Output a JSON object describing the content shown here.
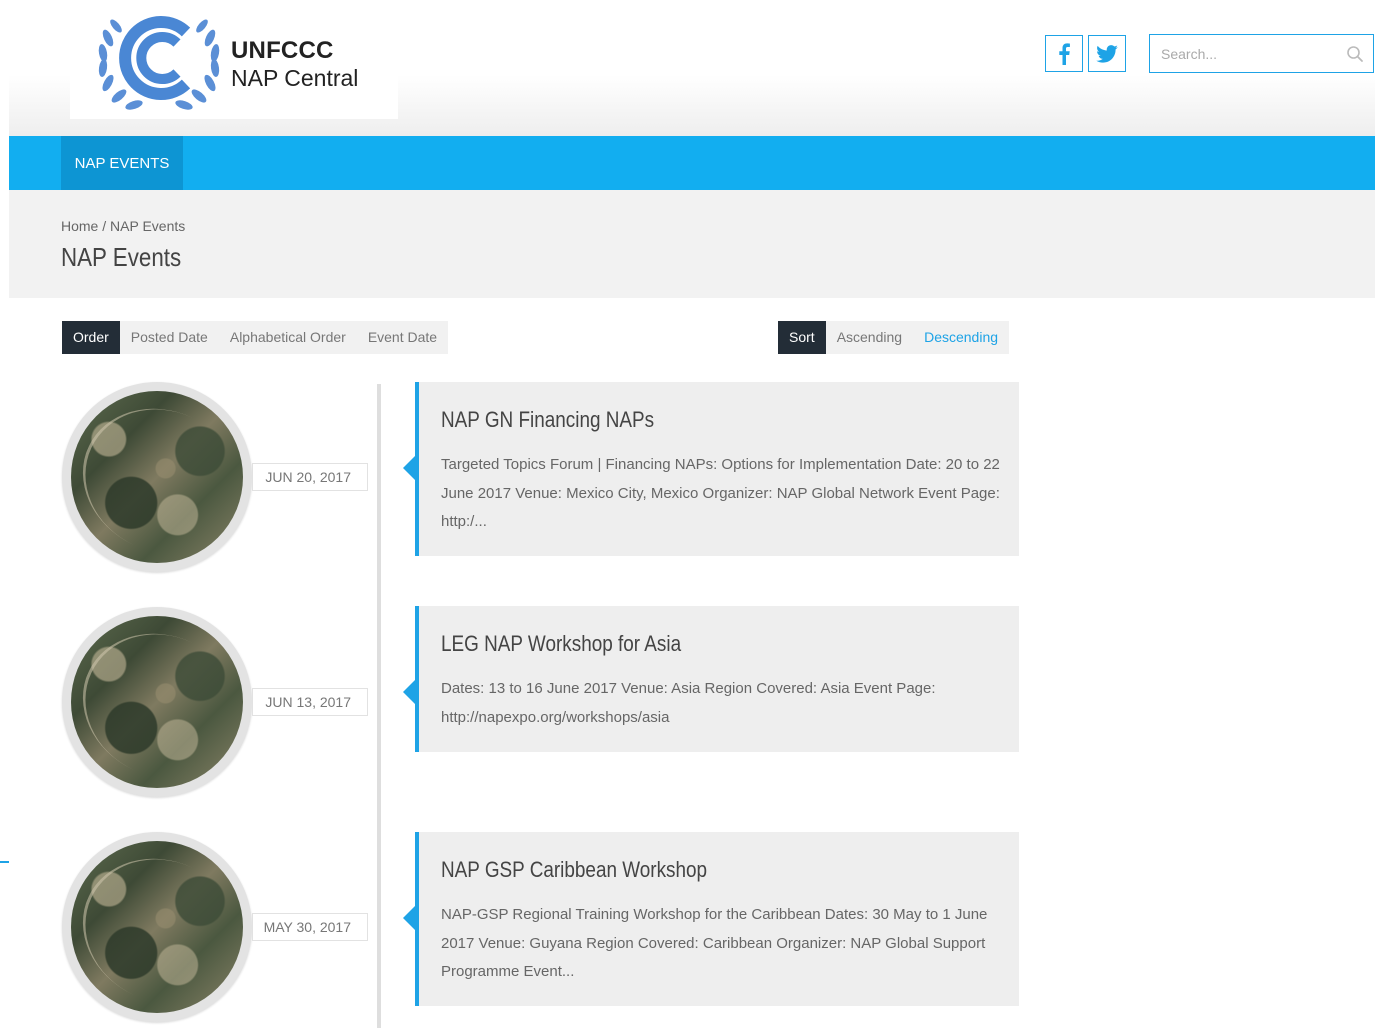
{
  "header": {
    "logo_title": "UNFCCC",
    "logo_subtitle": "NAP Central",
    "search_placeholder": "Search...",
    "social": [
      "facebook-icon",
      "twitter-icon"
    ]
  },
  "nav": {
    "items": [
      {
        "label": "NAP EVENTS"
      }
    ]
  },
  "title_band": {
    "breadcrumb_home": "Home",
    "breadcrumb_sep": " / ",
    "breadcrumb_current": "NAP Events",
    "title": "NAP Events"
  },
  "order_controls": {
    "label": "Order",
    "options": [
      "Posted Date",
      "Alphabetical Order",
      "Event Date"
    ]
  },
  "sort_controls": {
    "label": "Sort",
    "options": [
      "Ascending",
      "Descending"
    ],
    "selected": "Descending"
  },
  "events": [
    {
      "date": "JUN 20, 2017",
      "title": "NAP GN Financing NAPs",
      "excerpt": "Targeted Topics Forum | Financing NAPs: Options for Implementation Date: 20 to 22 June 2017 Venue: Mexico City, Mexico Organizer: NAP Global Network Event Page:  http:/..."
    },
    {
      "date": "JUN 13, 2017",
      "title": "LEG NAP Workshop for Asia",
      "excerpt": "Dates: 13 to 16 June 2017 Venue: Asia Region Covered: Asia Event Page: http://napexpo.org/workshops/asia"
    },
    {
      "date": "MAY 30, 2017",
      "title": "NAP GSP Caribbean Workshop",
      "excerpt": "NAP-GSP Regional Training Workshop for the Caribbean Dates: 30 May to 1 June 2017 Venue: Guyana Region Covered: Caribbean Organizer: NAP Global Support Programme Event..."
    }
  ],
  "colors": {
    "accent": "#12aef0",
    "accent_dark": "#0d95d3",
    "link_blue": "#1ea3e6",
    "dark_label": "#232d37",
    "card_bg": "#eeeeee"
  }
}
